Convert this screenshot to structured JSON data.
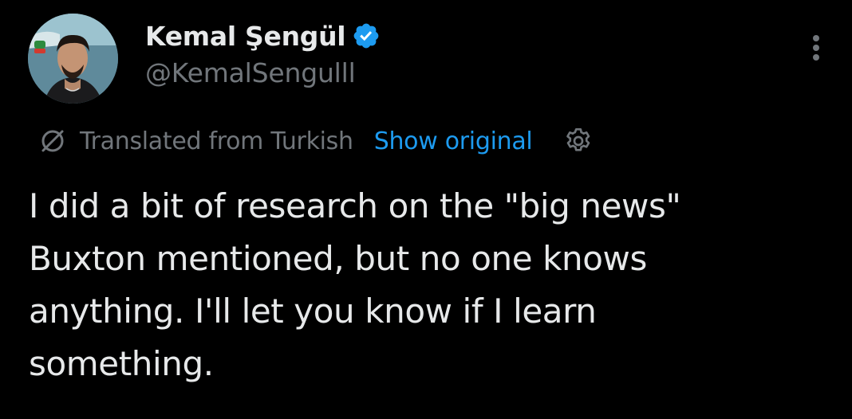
{
  "author": {
    "display_name": "Kemal Şengül",
    "handle": "@KemalSengulll",
    "verified": true
  },
  "translation": {
    "label": "Translated from Turkish",
    "show_original": "Show original"
  },
  "tweet": {
    "lines": [
      "I did a bit of research on the \"big news\"",
      "Buxton mentioned, but no one knows",
      "anything. I'll let you know if I learn",
      "something."
    ]
  },
  "icons": {
    "verified": "verified-badge-icon",
    "more": "more-options-icon",
    "translate": "translate-icon",
    "settings": "gear-icon"
  },
  "colors": {
    "background": "#000000",
    "primary_text": "#e7e9ea",
    "secondary_text": "#71767b",
    "link": "#1d9bf0",
    "verified": "#1d9bf0"
  }
}
